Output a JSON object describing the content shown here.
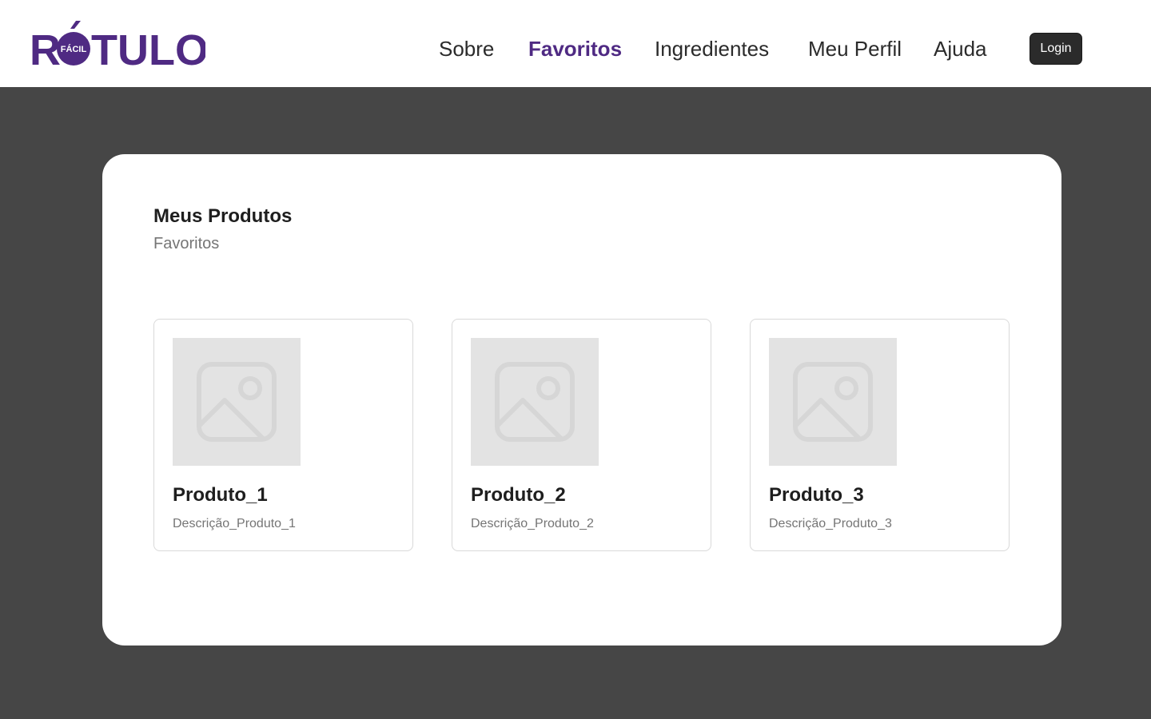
{
  "header": {
    "logo": {
      "wordmark": "RÓTULO",
      "badge": "FÁCIL"
    },
    "nav": [
      {
        "label": "Sobre",
        "active": false
      },
      {
        "label": "Favoritos",
        "active": true
      },
      {
        "label": "Ingredientes",
        "active": false
      },
      {
        "label": "Meu Perfil",
        "active": false
      },
      {
        "label": "Ajuda",
        "active": false
      }
    ],
    "login_label": "Login"
  },
  "main": {
    "title": "Meus Produtos",
    "subtitle": "Favoritos",
    "products": [
      {
        "name": "Produto_1",
        "description": "Descrição_Produto_1",
        "image_icon": "image-placeholder-icon"
      },
      {
        "name": "Produto_2",
        "description": "Descrição_Produto_2",
        "image_icon": "image-placeholder-icon"
      },
      {
        "name": "Produto_3",
        "description": "Descrição_Produto_3",
        "image_icon": "image-placeholder-icon"
      }
    ]
  },
  "colors": {
    "brand": "#4f2a83",
    "background": "#464646",
    "panel": "#ffffff",
    "button": "#2b2b2b",
    "placeholder": "#e3e3e3"
  }
}
